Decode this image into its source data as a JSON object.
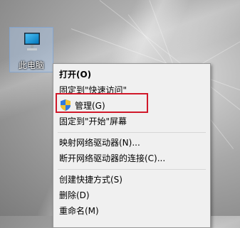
{
  "desktop": {
    "icon_label": "此电脑"
  },
  "context_menu": {
    "items": [
      {
        "label": "打开(O)"
      },
      {
        "label": "固定到\"快速访问\""
      },
      {
        "label": "管理(G)"
      },
      {
        "label": "固定到\"开始\"屏幕"
      },
      {
        "label": "映射网络驱动器(N)..."
      },
      {
        "label": "断开网络驱动器的连接(C)..."
      },
      {
        "label": "创建快捷方式(S)"
      },
      {
        "label": "删除(D)"
      },
      {
        "label": "重命名(M)"
      }
    ]
  },
  "colors": {
    "highlight": "#d0182a",
    "menu_bg": "#f0f0f0"
  }
}
